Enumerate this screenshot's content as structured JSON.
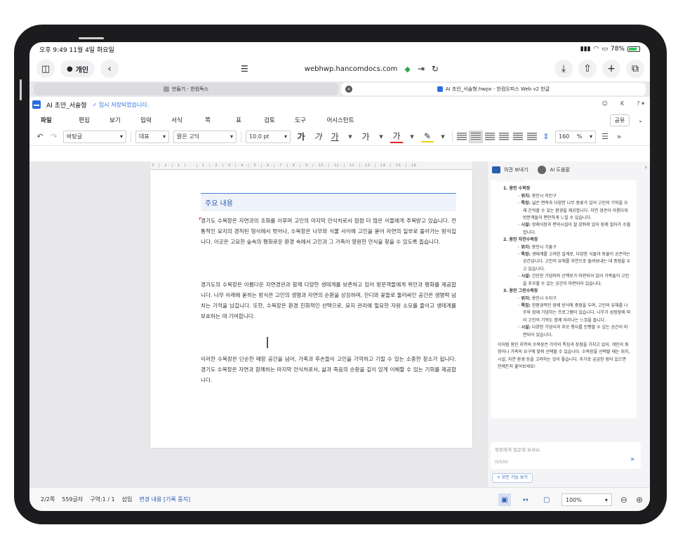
{
  "status": {
    "time_date": "오후 9:49  11월 4일 화요일",
    "battery": "78%"
  },
  "browser": {
    "profile": "개인",
    "url": "webhwp.hancomdocs.com",
    "tabs": [
      {
        "label": "만들기 - 한컴독스"
      },
      {
        "label": "AI 초안_서술형.hwpx - 한컴오피스 Web v2 한글"
      }
    ]
  },
  "app": {
    "doc_name": "AI 초안_서술형",
    "save_status": "✓ 임시 저장되었습니다.",
    "title_right": [
      "☺",
      "K",
      "? ▾"
    ]
  },
  "menu": {
    "items": [
      "파일",
      "편집",
      "보기",
      "입력",
      "서식",
      "쪽",
      "표",
      "검토",
      "도구",
      "어시스턴트"
    ],
    "share": "공유"
  },
  "toolbar": {
    "style_select": "바탕글",
    "lang_select": "대표",
    "font_select": "맑은 고딕",
    "size_select": "10.0  pt",
    "line_spacing": "160",
    "line_spacing_unit": "%"
  },
  "ruler_text": "3 · | · 2 · | · 1 · | · · · | · 1 · | · 2 · | · 3 · | · 4 · | · 5 · | · 6 · | · 7 · | · 8 · | · 9 · | · 10 · | · 11 · | · 12 · | · 13 · | · 14 · | · 15 · | · 16",
  "document": {
    "section_title": "주요 내용",
    "paragraphs": [
      "경기도 수목장은 자연과의 조화를 이루며 고인의 마지막 안식처로서 점점 더 많은 이들에게 주목받고 있습니다. 전통적인 묘지의 경직된 형식에서 벗어나, 수목장은 나무와 식물 사이에 고인을 묻어 자연의 일부로 돌아가는 방식입니다. 이곳은 고요한 숲속의 평화로운 환경 속에서 고인과 그 가족이 영원한 안식을 찾을 수 있도록 돕습니다.",
      "경기도의 수목장은 아름다운 자연경관과 함께 다양한 생태계를 보존하고 있어 방문객들에게 위안과 평화를 제공합니다. 나무 아래에 묻히는 방식은 고인의 생명과 자연의 순환을 상징하며, 잔디와 꽃들로 둘러싸인 공간은 생명력 넘치는 기억을 남깁니다. 또한, 수목장은 환경 친화적인 선택으로, 묘지 관리에 필요한 자원 소모를 줄이고 생태계를 보호하는 데 기여합니다.",
      "이러한 수목장은 단순한 매장 공간을 넘어, 가족과 후손들이 고인을 기억하고 기릴 수 있는 소중한 장소가 됩니다. 경기도 수목장은 자연과 함께하는 마지막 안식처로서, 삶과 죽음의 순환을 깊이 있게 이해할 수 있는 기회를 제공합니다."
    ]
  },
  "sidepanel": {
    "tabs": [
      "의견 보내기",
      "AI 도움말"
    ],
    "top_cut": "··· · ·· · ·· · ··· ·",
    "items": [
      {
        "title": "1. 용인 수목장",
        "bullets": [
          {
            "k": "위치:",
            "v": " 용인시 처인구"
          },
          {
            "k": "특징:",
            "v": " 넓은 면적과 다양한 나무 종류가 있어 고인의 기억을 오래 간직할 수 있는 환경을 제공합니다. 자연 경관이 아름다워 방문객들이 편안하게 느낄 수 있습니다."
          },
          {
            "k": "시설:",
            "v": " 장례식장과 편의시설이 잘 갖춰져 있어 장례 절차가 수월합니다."
          }
        ]
      },
      {
        "title": "2. 용인 자연수목장",
        "bullets": [
          {
            "k": "위치:",
            "v": " 용인시 기흥구"
          },
          {
            "k": "특징:",
            "v": " 생태계를 고려한 설계로, 다양한 식물과 동물이 공존하는 공간입니다. 고인의 유해를 자연으로 돌려보내는 데 중점을 두고 있습니다."
          },
          {
            "k": "시설:",
            "v": " 간단한 기념비와 산책로가 마련되어 있어 가족들이 고인을 추모할 수 있는 공간이 마련되어 있습니다."
          }
        ]
      },
      {
        "title": "3. 용인 그린수목장",
        "bullets": [
          {
            "k": "위치:",
            "v": " 용인시 수지구"
          },
          {
            "k": "특징:",
            "v": " 친환경적인 장례 방식에 중점을 두며, 고인의 유해를 나무와 함께 기념하는 프로그램이 있습니다. 나무가 성장함에 따라 고인의 기억도 함께 자라나는 느낌을 줍니다."
          },
          {
            "k": "시설:",
            "v": " 다양한 기념식과 추모 행사를 진행할 수 있는 공간이 마련되어 있습니다."
          }
        ]
      }
    ],
    "conclusion": "이처럼 용인 지역의 수목장은 각각의 특징과 장점을 가지고 있어, 개인의 취향이나 가족의 요구에 맞춰 선택할 수 있습니다. 수목장을 선택할 때는 위치, 시설, 자연 환경 등을 고려하는 것이 좋습니다. 추가로 궁금한 점이 있으면 언제든지 물어보세요!",
    "input_placeholder": "챗봇에게 질문해 보세요.",
    "char_count": "0/500",
    "all_features": "+ 모든 기능 보기"
  },
  "bottom": {
    "page": "2/2쪽",
    "chars": "559글자",
    "section": "구역:1 / 1",
    "mode": "삽입",
    "change": "변경 내용 [기록 중지]",
    "zoom": "100%"
  }
}
